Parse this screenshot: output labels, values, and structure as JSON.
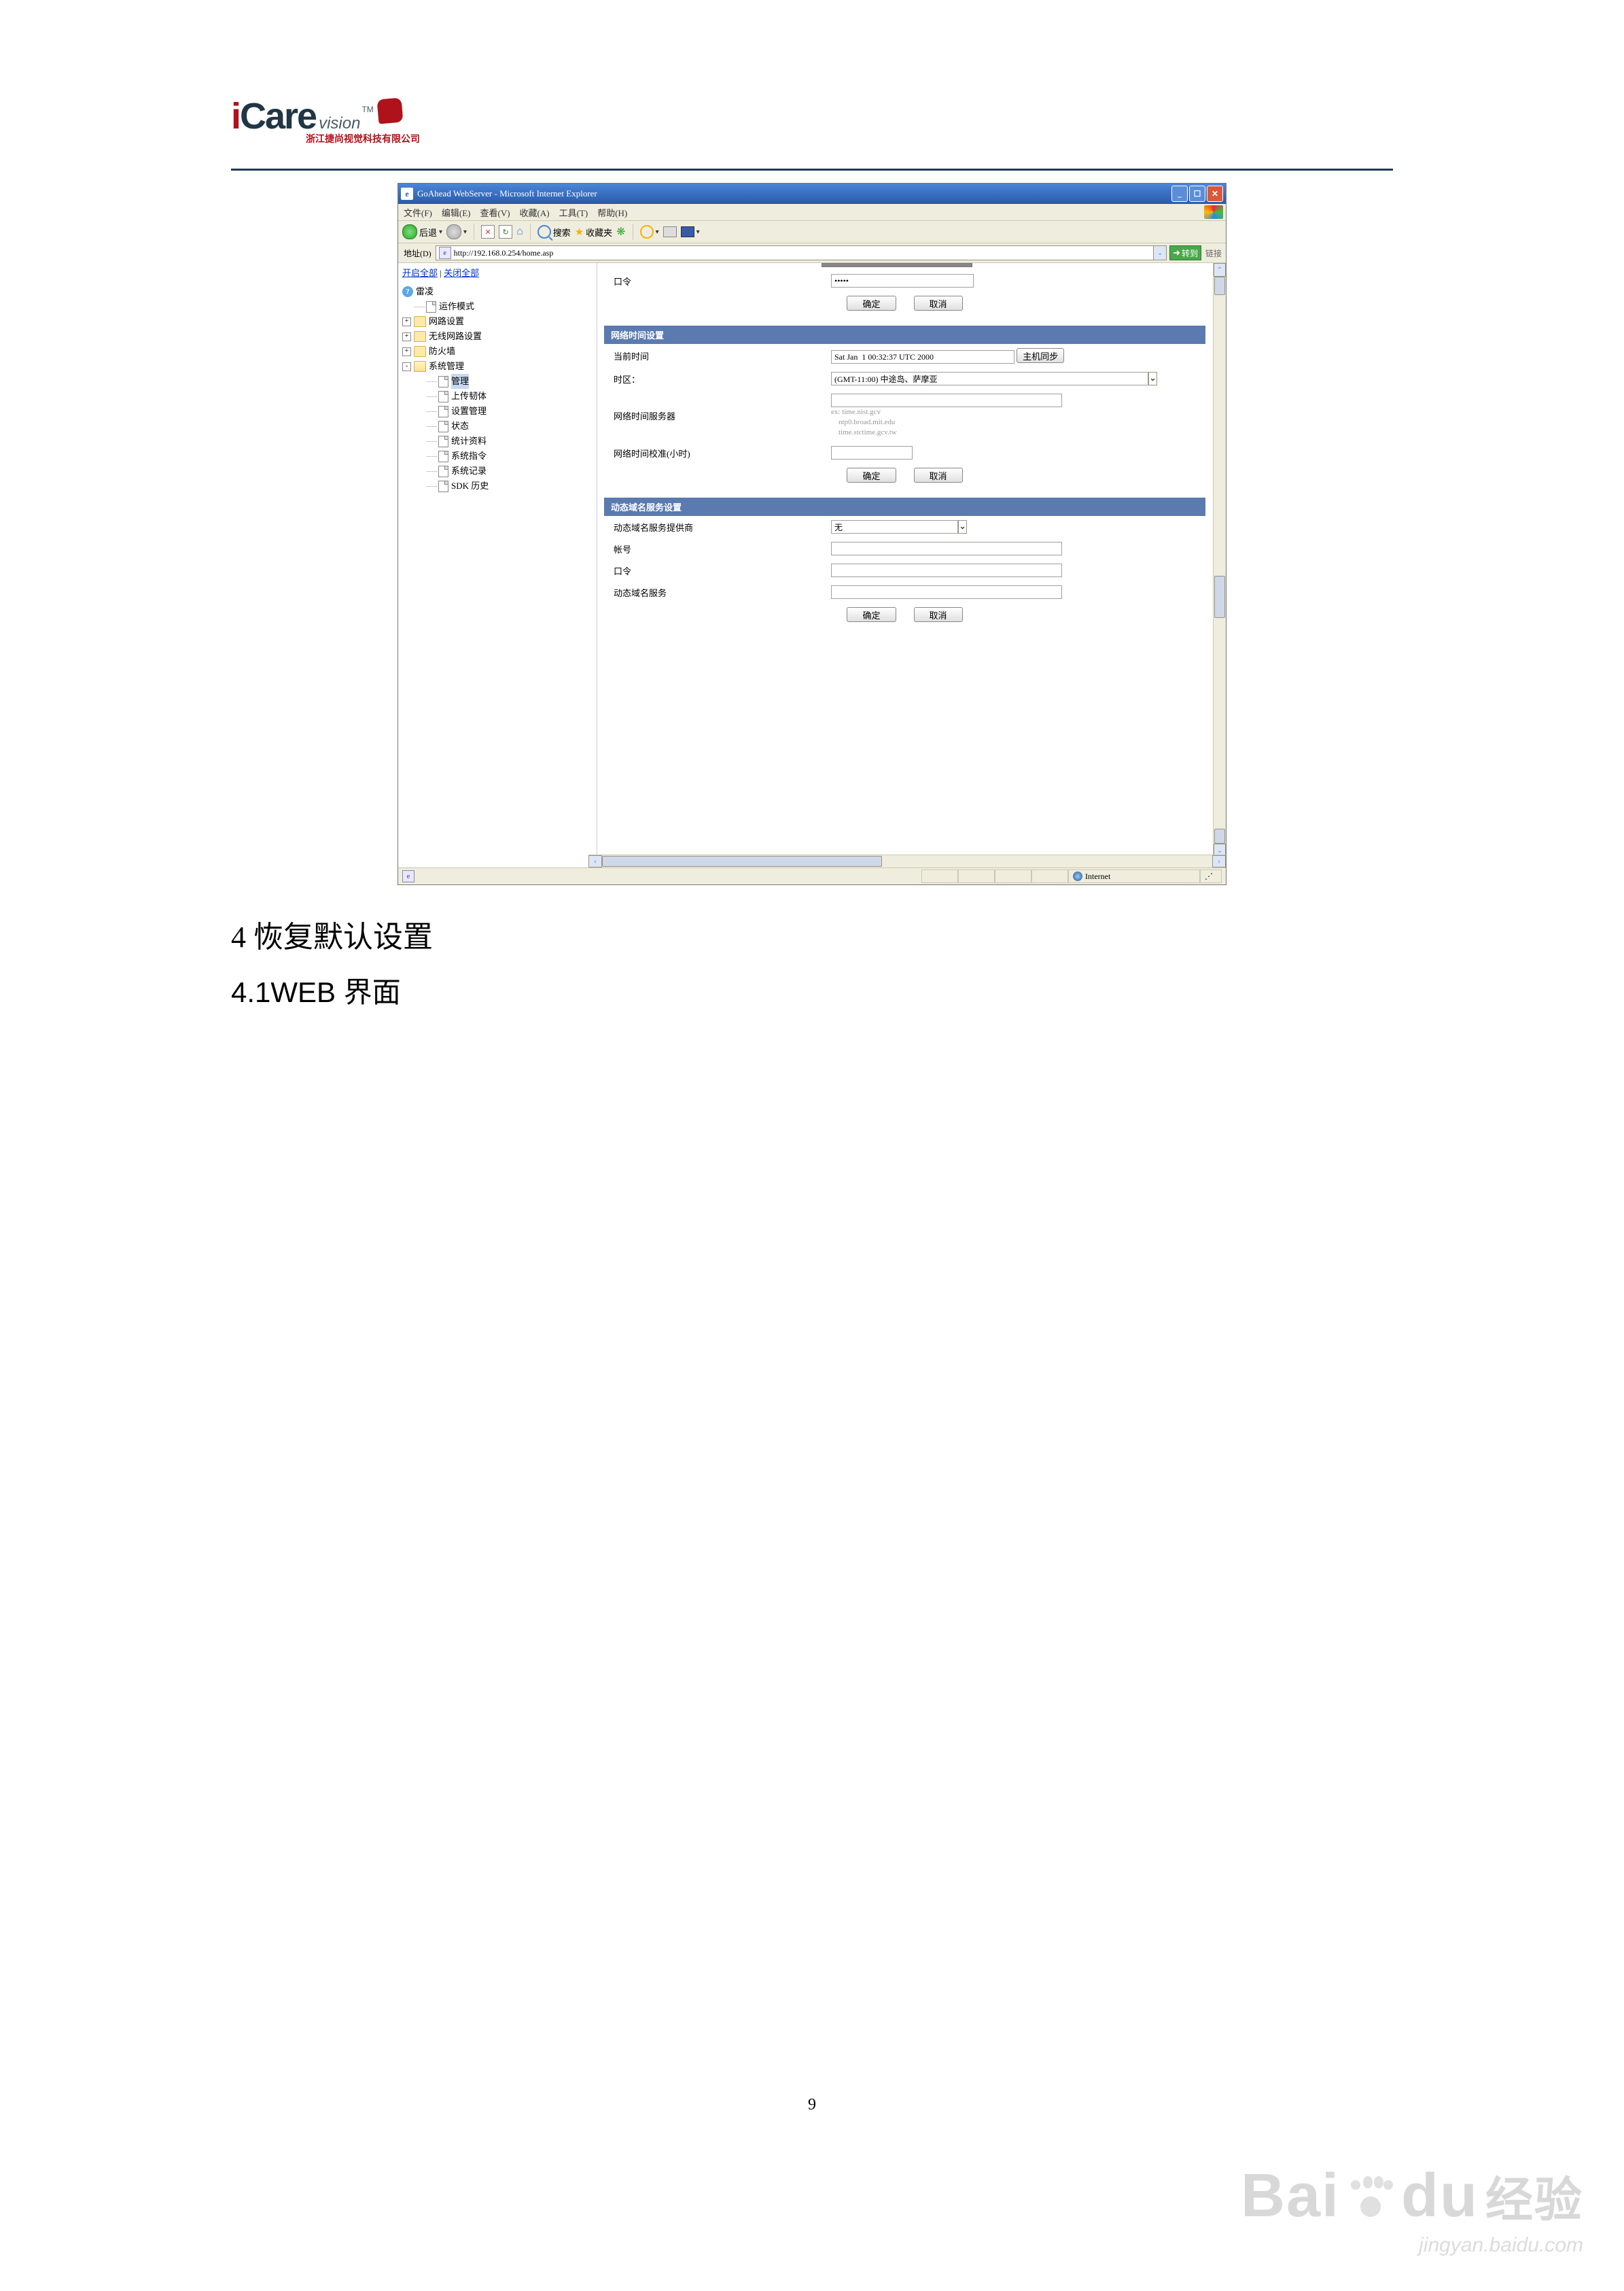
{
  "logo": {
    "line1_pre": "i",
    "line1_mid": "Care",
    "vision": "vision",
    "tm": "TM",
    "cn": "浙江捷尚视觉科技有限公司"
  },
  "window_title": "GoAhead WebServer - Microsoft Internet Explorer",
  "menus": [
    "文件(F)",
    "编辑(E)",
    "查看(V)",
    "收藏(A)",
    "工具(T)",
    "帮助(H)"
  ],
  "toolbar": {
    "back": "后退",
    "search": "搜索",
    "favs": "收藏夹"
  },
  "address_bar": {
    "label": "地址(D)",
    "url": "http://192.168.0.254/home.asp",
    "go": "转到",
    "links": "链接"
  },
  "left_panel": {
    "open_all": "开启全部",
    "close_all": "关闭全部",
    "tree": [
      {
        "icon": "q",
        "label": "雷凌",
        "depth": 0
      },
      {
        "icon": "page",
        "label": "运作模式",
        "depth": 1
      },
      {
        "icon": "folder",
        "expand": "+",
        "label": "网路设置",
        "depth": 0
      },
      {
        "icon": "folder",
        "expand": "+",
        "label": "无线网路设置",
        "depth": 0
      },
      {
        "icon": "folder",
        "expand": "+",
        "label": "防火墙",
        "depth": 0
      },
      {
        "icon": "folder-open",
        "expand": "-",
        "label": "系统管理",
        "depth": 0
      },
      {
        "icon": "page",
        "label": "管理",
        "depth": 2,
        "selected": true
      },
      {
        "icon": "page",
        "label": "上传韧体",
        "depth": 2
      },
      {
        "icon": "page",
        "label": "设置管理",
        "depth": 2
      },
      {
        "icon": "page",
        "label": "状态",
        "depth": 2
      },
      {
        "icon": "page",
        "label": "统计资料",
        "depth": 2
      },
      {
        "icon": "page",
        "label": "系统指令",
        "depth": 2
      },
      {
        "icon": "page",
        "label": "系统记录",
        "depth": 2
      },
      {
        "icon": "page",
        "label": "SDK 历史",
        "depth": 2
      }
    ]
  },
  "forms": {
    "password": {
      "label": "口令",
      "value": "•••••",
      "ok": "确定",
      "cancel": "取消"
    },
    "time": {
      "header": "网络时间设置",
      "now_label": "当前时间",
      "now_value": "Sat Jan  1 00:32:37 UTC 2000",
      "sync_btn": "主机同步",
      "tz_label": "时区：",
      "tz_value": "(GMT-11:00) 中途岛、萨摩亚",
      "ntp_label": "网络时间服务器",
      "ntp_placeholder": "ex: time.nist.gcv\n    ntp0.broad.mit.edu\n    time.stctime.gcv.tw",
      "calib_label": "网络时间校准(小时)",
      "ok": "确定",
      "cancel": "取消"
    },
    "ddns": {
      "header": "动态域名服务设置",
      "provider_label": "动态域名服务提供商",
      "provider_value": "无",
      "account_label": "帐号",
      "password_label": "口令",
      "domain_label": "动态域名服务",
      "ok": "确定",
      "cancel": "取消"
    }
  },
  "status_bar": {
    "zone": "Internet"
  },
  "headings": {
    "h4": "4 恢复默认设置",
    "h41": "4.1WEB 界面"
  },
  "page_num": "9",
  "watermark": {
    "brand_a": "Bai",
    "brand_b": "du",
    "cn": "经验",
    "url": "jingyan.baidu.com"
  }
}
